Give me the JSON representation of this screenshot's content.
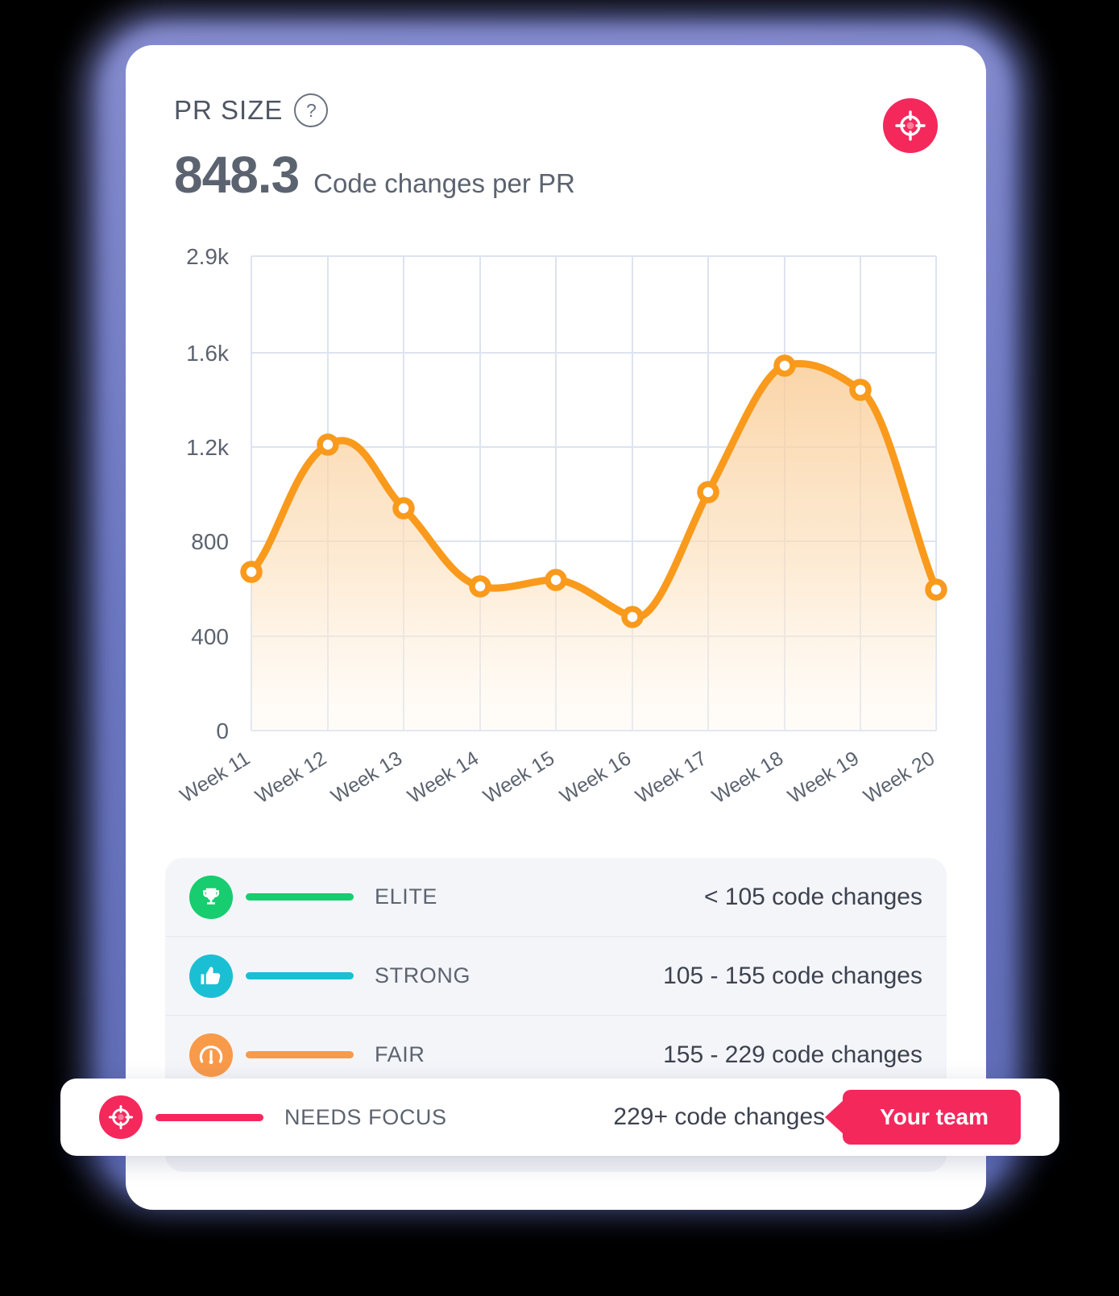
{
  "header": {
    "metric_label": "PR SIZE",
    "help_icon": "question-mark-icon",
    "value": "848.3",
    "unit": "Code changes per PR",
    "target_icon": "crosshair-target-icon",
    "accent_color": "#f5285c"
  },
  "chart_data": {
    "type": "area",
    "title": "PR SIZE",
    "xlabel": "",
    "ylabel": "",
    "categories": [
      "Week 11",
      "Week 12",
      "Week 13",
      "Week 14",
      "Week 15",
      "Week 16",
      "Week 17",
      "Week 18",
      "Week 19",
      "Week 20"
    ],
    "values": [
      640,
      1290,
      1000,
      690,
      720,
      540,
      1150,
      1660,
      1550,
      680
    ],
    "yticks": [
      "0",
      "400",
      "800",
      "1.2k",
      "1.6k",
      "2.9k"
    ],
    "ytick_values": [
      0,
      400,
      800,
      1200,
      1600,
      2900
    ],
    "ylim": [
      0,
      2900
    ],
    "grid": true,
    "legend_position": "below-chart",
    "line_color": "#f99a1c",
    "fill_color": "#fbe3c2",
    "marker": "open-circle"
  },
  "legend": {
    "rows": [
      {
        "label": "ELITE",
        "range": "< 105 code changes",
        "color": "#17cd6f",
        "icon": "trophy-icon"
      },
      {
        "label": "STRONG",
        "range": "105 - 155 code changes",
        "color": "#1bbfd4",
        "icon": "thumbs-up-icon"
      },
      {
        "label": "FAIR",
        "range": "155 - 229  code changes",
        "color": "#f99a4a",
        "icon": "gauge-icon"
      }
    ],
    "focus": {
      "label": "NEEDS FOCUS",
      "range": "229+ code changes",
      "color": "#f5285c",
      "icon": "crosshair-target-icon",
      "badge": "Your team"
    }
  }
}
